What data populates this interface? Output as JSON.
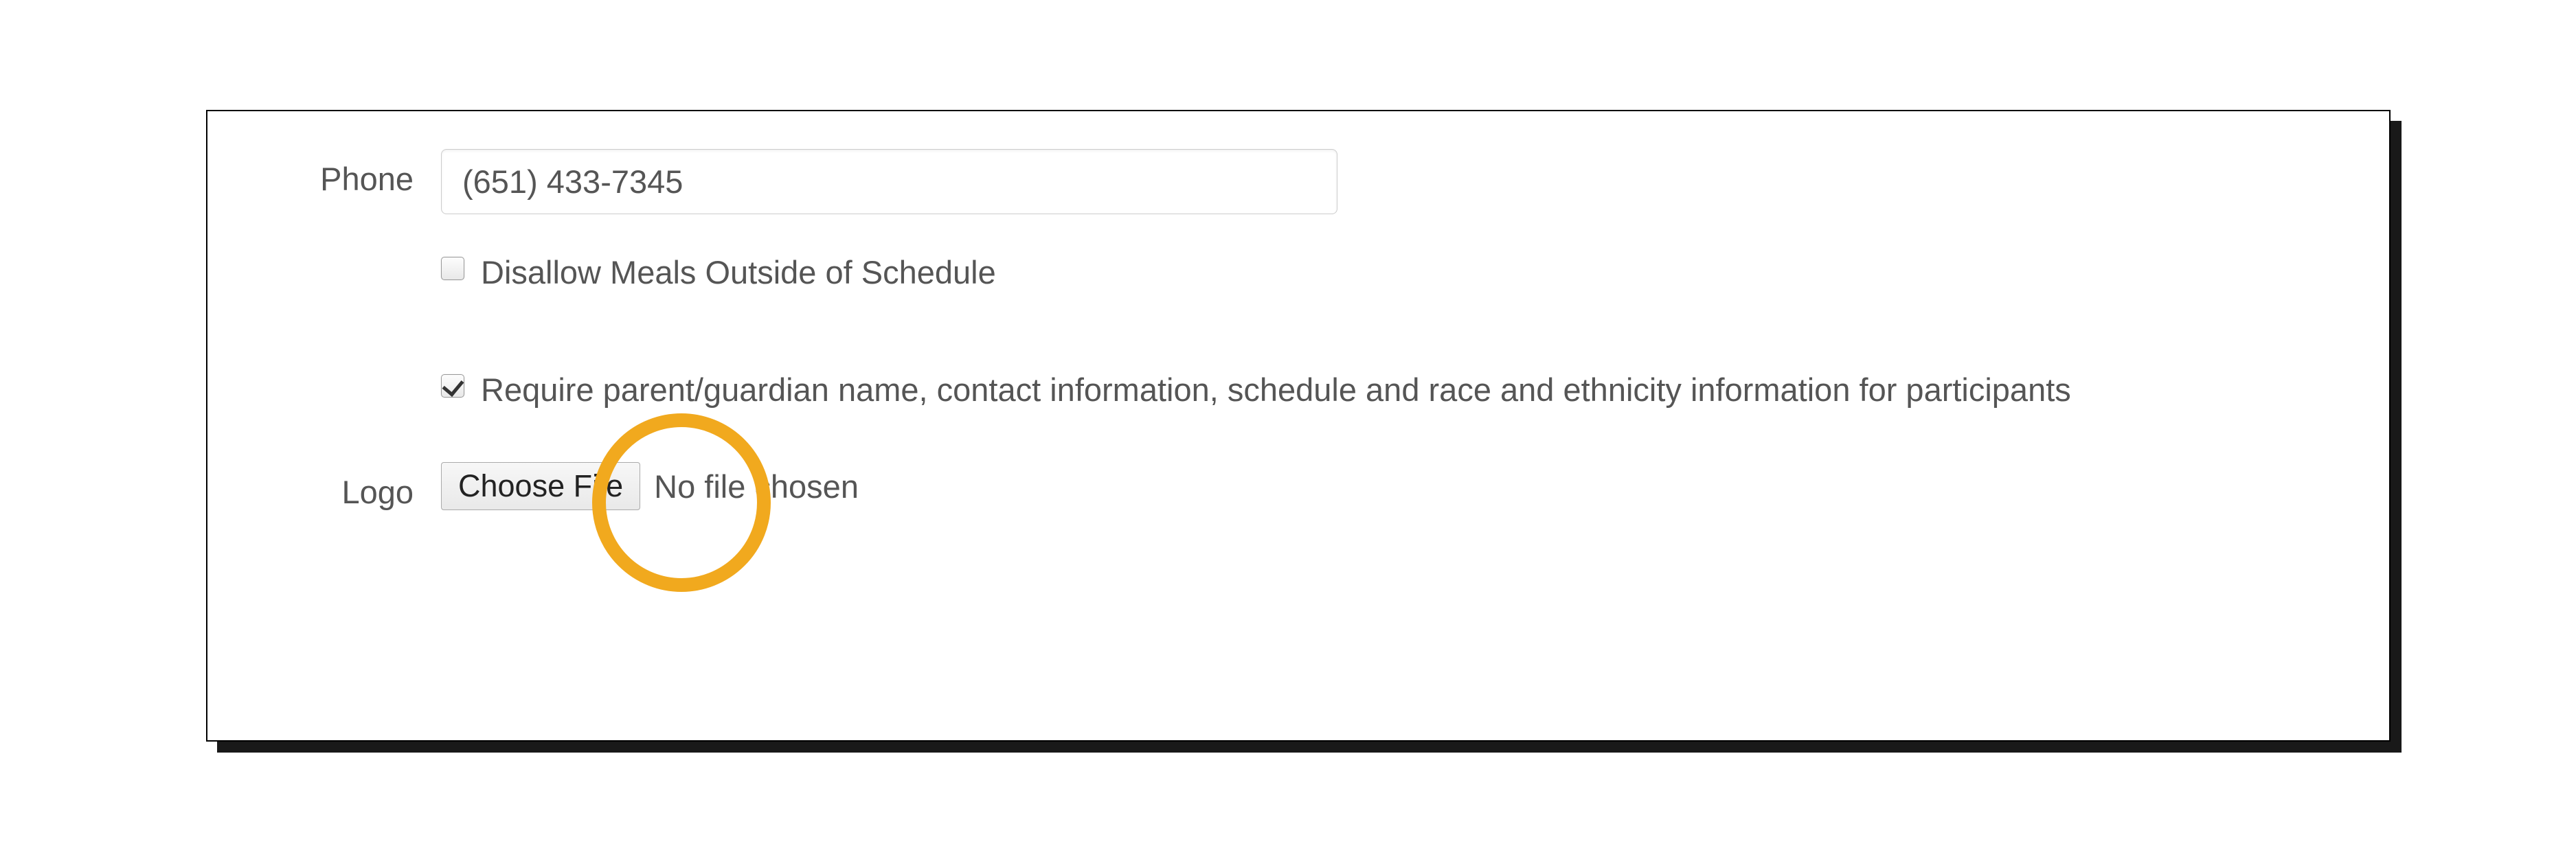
{
  "form": {
    "phone": {
      "label": "Phone",
      "value": "(651) 433-7345"
    },
    "disallow_meals": {
      "label": "Disallow Meals Outside of Schedule",
      "checked": false
    },
    "require_info": {
      "label": "Require parent/guardian name, contact information, schedule and race and ethnicity information for participants",
      "checked": true
    },
    "logo": {
      "label": "Logo",
      "button": "Choose File",
      "status": "No file chosen"
    }
  },
  "annotation": {
    "highlight_color": "#f1a91e"
  }
}
